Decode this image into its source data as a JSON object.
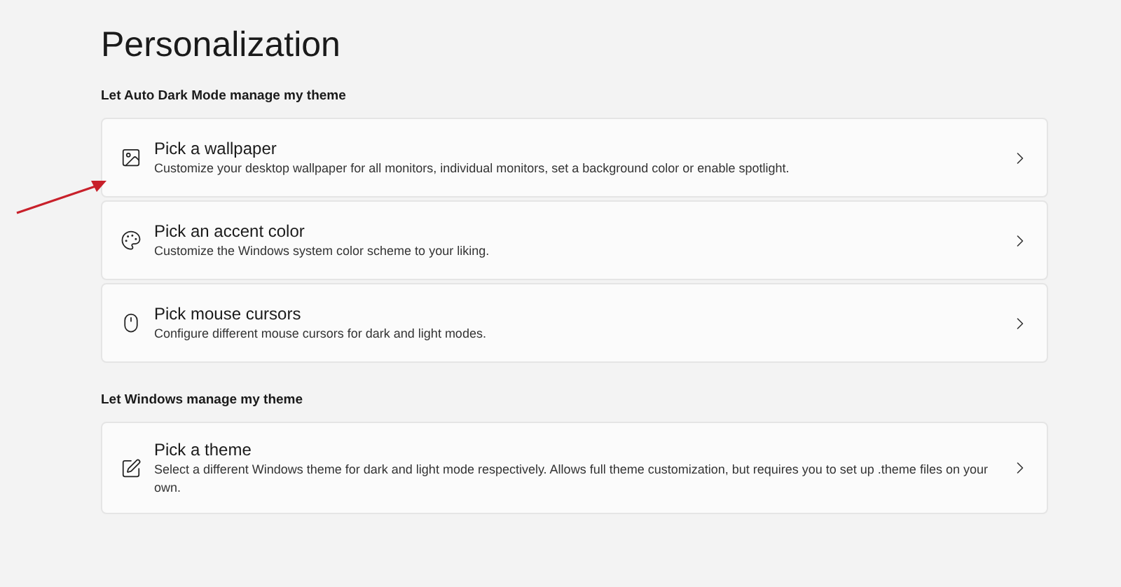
{
  "page_title": "Personalization",
  "sections": [
    {
      "heading": "Let Auto Dark Mode manage my theme",
      "cards": [
        {
          "kind": "wallpaper",
          "title": "Pick a wallpaper",
          "description": "Customize your desktop wallpaper for all monitors, individual monitors, set a background color or enable spotlight."
        },
        {
          "kind": "palette",
          "title": "Pick an accent color",
          "description": "Customize the Windows system color scheme to your liking."
        },
        {
          "kind": "mouse",
          "title": "Pick mouse cursors",
          "description": "Configure different mouse cursors for dark and light modes."
        }
      ]
    },
    {
      "heading": "Let Windows manage my theme",
      "cards": [
        {
          "kind": "theme",
          "title": "Pick a theme",
          "description": "Select a different Windows theme for dark and light mode respectively. Allows full theme customization, but requires you to set up .theme files on your own."
        }
      ]
    }
  ]
}
